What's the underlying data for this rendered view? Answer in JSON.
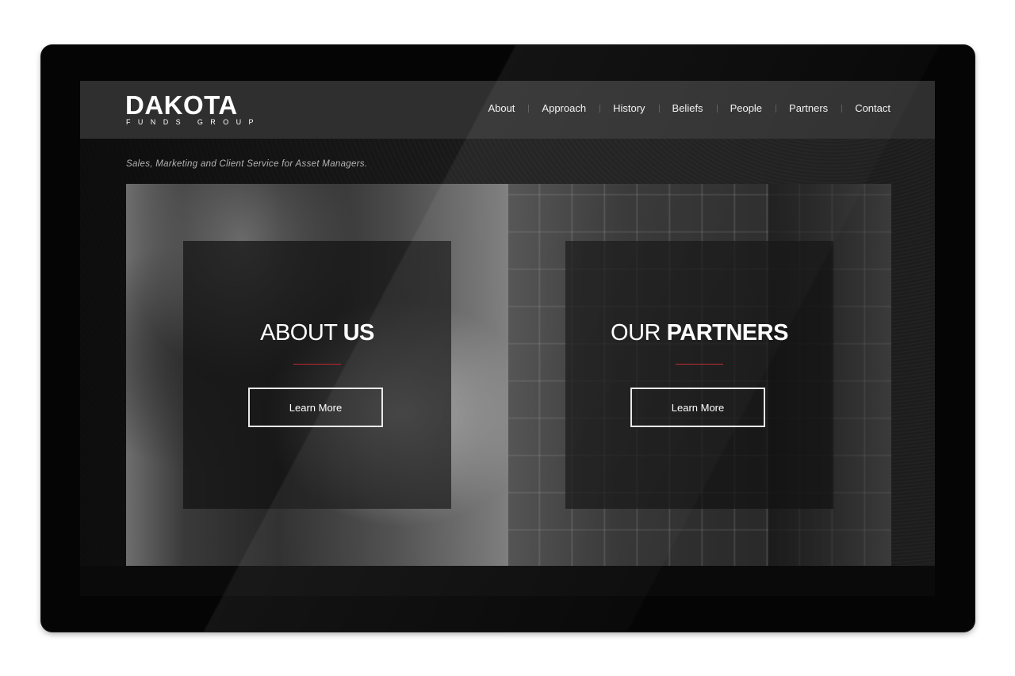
{
  "brand": {
    "name": "DAKOTA",
    "subname": "FUNDS GROUP",
    "tagline": "Sales, Marketing and Client Service for Asset Managers."
  },
  "nav": {
    "items": [
      {
        "label": "About"
      },
      {
        "label": "Approach"
      },
      {
        "label": "History"
      },
      {
        "label": "Beliefs"
      },
      {
        "label": "People"
      },
      {
        "label": "Partners"
      },
      {
        "label": "Contact"
      }
    ]
  },
  "cards": [
    {
      "title_light": "ABOUT",
      "title_bold": "US",
      "button": "Learn More"
    },
    {
      "title_light": "OUR",
      "title_bold": "PARTNERS",
      "button": "Learn More"
    }
  ],
  "colors": {
    "accent": "#c0272d",
    "header_bg": "#2f2f2f",
    "text": "#ffffff"
  }
}
